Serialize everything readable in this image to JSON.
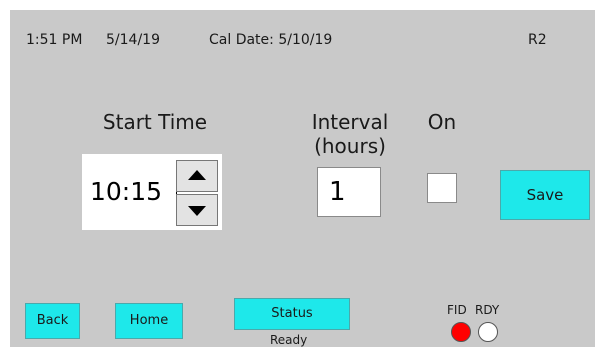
{
  "header": {
    "time": "1:51 PM",
    "date": "5/14/19",
    "cal_date": "Cal Date: 5/10/19",
    "device_id": "R2"
  },
  "schedule": {
    "start_time_label": "Start Time",
    "start_time_value": "10:15",
    "interval_label_line1": "Interval",
    "interval_label_line2": "(hours)",
    "interval_value": "1",
    "on_label": "On",
    "on_checked": false,
    "save_label": "Save"
  },
  "footer": {
    "back_label": "Back",
    "home_label": "Home",
    "status_label": "Status",
    "status_text": "Ready",
    "fid_label": "FID",
    "rdy_label": "RDY",
    "fid_color": "#ff0000",
    "rdy_color": "#ffffff"
  },
  "colors": {
    "background": "#c9c9c9",
    "button": "#1ee8ea"
  }
}
